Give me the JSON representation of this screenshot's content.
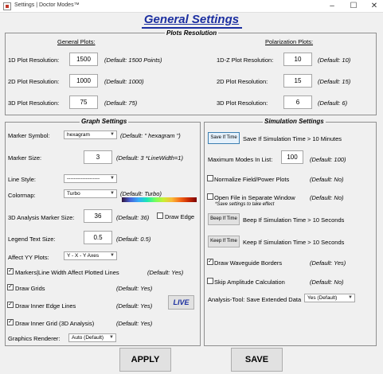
{
  "window": {
    "title": "Settings | Doctor Modes™",
    "controls": [
      "–",
      "☐",
      "✕"
    ]
  },
  "heading": "General Settings",
  "plots_resolution": {
    "title": "Plots Resolution",
    "general": {
      "header": "General Plots:",
      "rows": [
        {
          "label": "1D Plot Resolution:",
          "value": "1500",
          "default": "(Default: 1500 Points)"
        },
        {
          "label": "2D Plot Resolution:",
          "value": "1000",
          "default": "(Default: 1000)"
        },
        {
          "label": "3D Plot Resolution:",
          "value": "75",
          "default": "(Default: 75)"
        }
      ]
    },
    "polarization": {
      "header": "Polarization Plots:",
      "rows": [
        {
          "label": "1D-Z Plot Resolution:",
          "value": "10",
          "default": "(Default: 10)"
        },
        {
          "label": "2D Plot Resolution:",
          "value": "15",
          "default": "(Default: 15)"
        },
        {
          "label": "3D Plot Resolution:",
          "value": "6",
          "default": "(Default: 6)"
        }
      ]
    }
  },
  "graph_settings": {
    "title": "Graph Settings",
    "marker_symbol": {
      "label": "Marker Symbol:",
      "value": "hexagram",
      "default": "(Default: \" hexagram \")"
    },
    "marker_size": {
      "label": "Marker Size:",
      "value": "3",
      "default": "(Default: 3  *LineWidth=1)"
    },
    "line_style": {
      "label": "Line Style:",
      "value": "-------------------"
    },
    "colormap": {
      "label": "Colormap:",
      "value": "Turbo",
      "default": "(Default: Turbo)"
    },
    "analysis_marker": {
      "label": "3D Analysis Marker Size:",
      "value": "36",
      "default": "(Default: 36)",
      "draw_edge": "Draw Edge",
      "draw_edge_checked": false
    },
    "legend": {
      "label": "Legend Text Size:",
      "value": "0.5",
      "default": "(Default: 0.5)"
    },
    "affect_yy": {
      "label": "Affect YY Plots:",
      "value": "Y - X - Y  Axes"
    },
    "markers_line": {
      "label": "Markers|Line Width Affect Plotted Lines",
      "default": "(Default: Yes)",
      "checked": true
    },
    "draw_grids": {
      "label": "Draw Grids",
      "default": "(Default: Yes)",
      "checked": true
    },
    "inner_edge": {
      "label": "Draw Inner Edge Lines",
      "default": "(Default: Yes)",
      "checked": true
    },
    "inner_grid": {
      "label": "Draw Inner Grid (3D Analysis)",
      "default": "(Default: Yes)",
      "checked": true
    },
    "live_label": "LIVE",
    "renderer": {
      "label": "Graphics Renderer:",
      "value": "Auto (Default)"
    }
  },
  "simulation_settings": {
    "title": "Simulation Settings",
    "save_if_time": {
      "button": "Save If Time",
      "label": "Save If Simulation Time > 10 Minutes"
    },
    "max_modes": {
      "label": "Maximum Modes In List:",
      "value": "100",
      "default": "(Default: 100)"
    },
    "normalize": {
      "label": "Normalize Field/Power Plots",
      "default": "(Default: No)",
      "checked": false
    },
    "open_file": {
      "label": "Open File in Separate Window",
      "default": "(Default: No)",
      "note": "*Save settings to take effect",
      "checked": false
    },
    "beep": {
      "button": "Beep If Time",
      "label": "Beep If Simulation Time > 10 Seconds"
    },
    "keep": {
      "button": "Keep If Time",
      "label": "Keep If Simulation Time > 10 Seconds"
    },
    "waveguide": {
      "label": "Draw Waveguide Borders",
      "default": "(Default: Yes)",
      "checked": true
    },
    "skip_amp": {
      "label": "Skip Amplitude Calculation",
      "default": "(Default: No)",
      "checked": false
    },
    "analysis_tool": {
      "label": "Analysis-Tool: Save Extended Data",
      "value": "Yes (Default)"
    }
  },
  "buttons": {
    "apply": "APPLY",
    "save": "SAVE"
  }
}
